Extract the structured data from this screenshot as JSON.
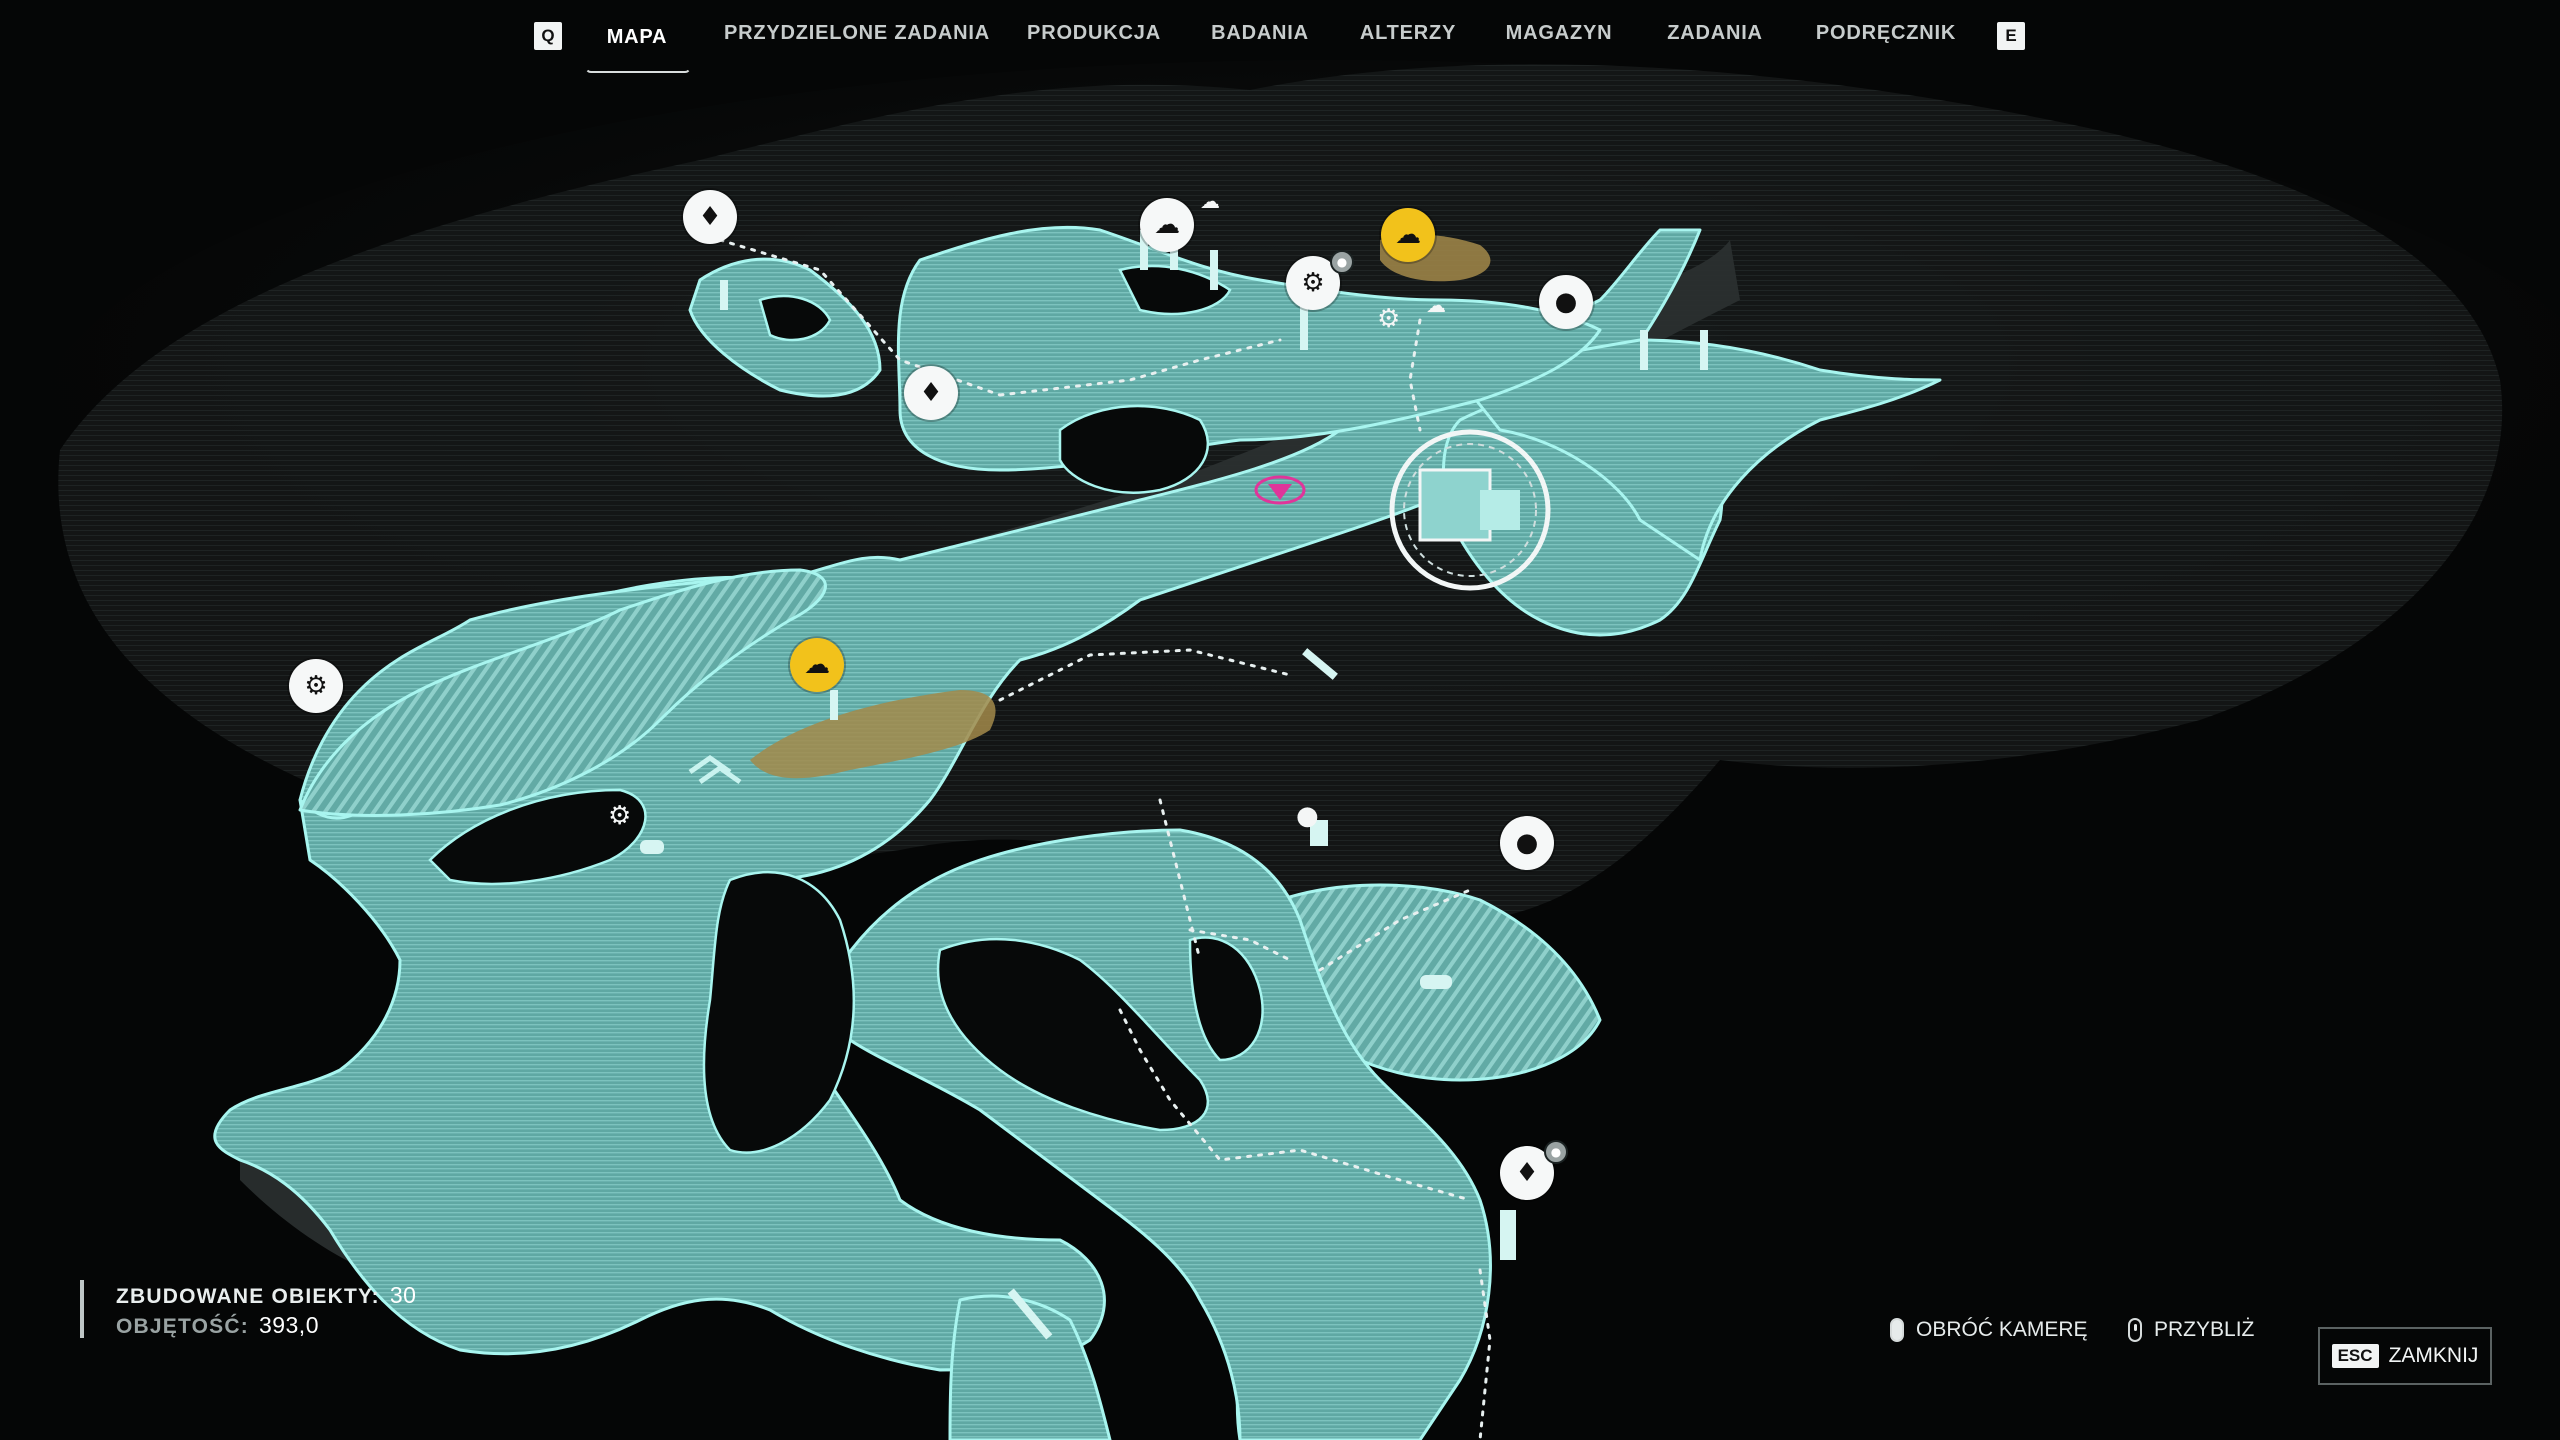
{
  "nav": {
    "prev_key": "Q",
    "next_key": "E",
    "tabs": [
      {
        "label": "MAPA",
        "active": true
      },
      {
        "label": "PRZYDZIELONE ZADANIA",
        "active": false
      },
      {
        "label": "PRODUKCJA",
        "active": false
      },
      {
        "label": "BADANIA",
        "active": false
      },
      {
        "label": "ALTERZY",
        "active": false
      },
      {
        "label": "MAGAZYN",
        "active": false
      },
      {
        "label": "ZADANIA",
        "active": false
      },
      {
        "label": "PODRĘCZNIK",
        "active": false
      }
    ]
  },
  "stats": {
    "built_label": "ZBUDOWANE OBIEKTY:",
    "built_value": "30",
    "volume_label": "OBJĘTOŚĆ:",
    "volume_value": "393,0"
  },
  "controls": {
    "rotate_label": "OBRÓĆ KAMERĘ",
    "zoom_label": "PRZYBLIŻ",
    "close_key": "ESC",
    "close_label": "ZAMKNIJ"
  },
  "markers": {
    "ore": "diamond-ore-icon",
    "water": "water-drop-icon",
    "gear": "gear-icon",
    "resource": "resource-pile-icon"
  },
  "colors": {
    "terrain": "#6bb5b0",
    "terrain_edge": "#a8f5ef",
    "background": "#050606",
    "highlight": "#f2c21b",
    "player": "#e0359a"
  }
}
